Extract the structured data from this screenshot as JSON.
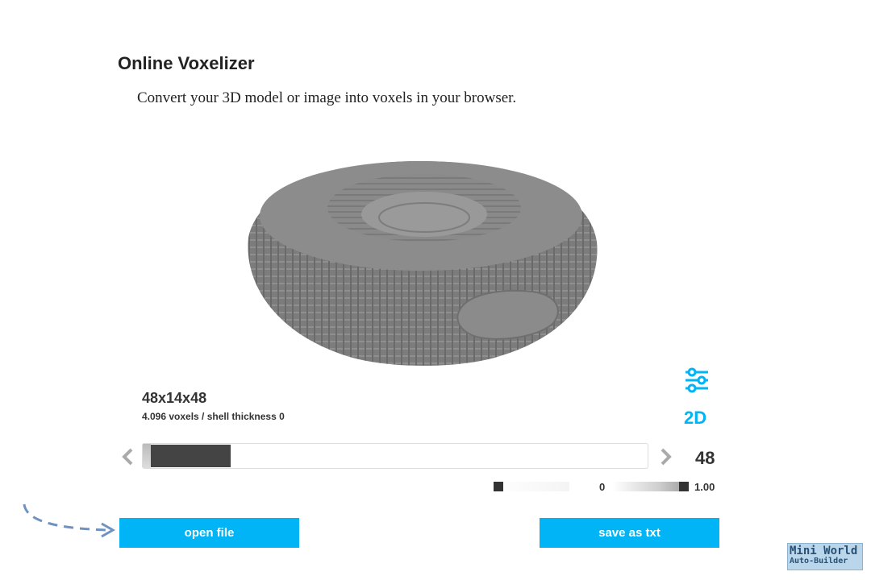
{
  "page": {
    "title": "Online Voxelizer",
    "subtitle": "Convert your 3D model or image into voxels in your browser."
  },
  "model": {
    "dimensions": "48x14x48",
    "voxel_info": "4.096 voxels / shell thickness 0"
  },
  "toolbar": {
    "settings_icon": "sliders-icon",
    "mode_label": "2D"
  },
  "resolution_slider": {
    "value_label": "48",
    "fill_fraction": 0.16
  },
  "threshold_range": {
    "min_label": "0",
    "max_label": "1.00"
  },
  "actions": {
    "open_label": "open file",
    "save_label": "save as txt"
  },
  "watermark": {
    "line1": "Mini World",
    "line2": "Auto-Builder"
  },
  "colors": {
    "accent": "#00b4f5",
    "voxel_top": "#8c8c8c",
    "voxel_side": "#737373",
    "slider_fill": "#444444"
  }
}
